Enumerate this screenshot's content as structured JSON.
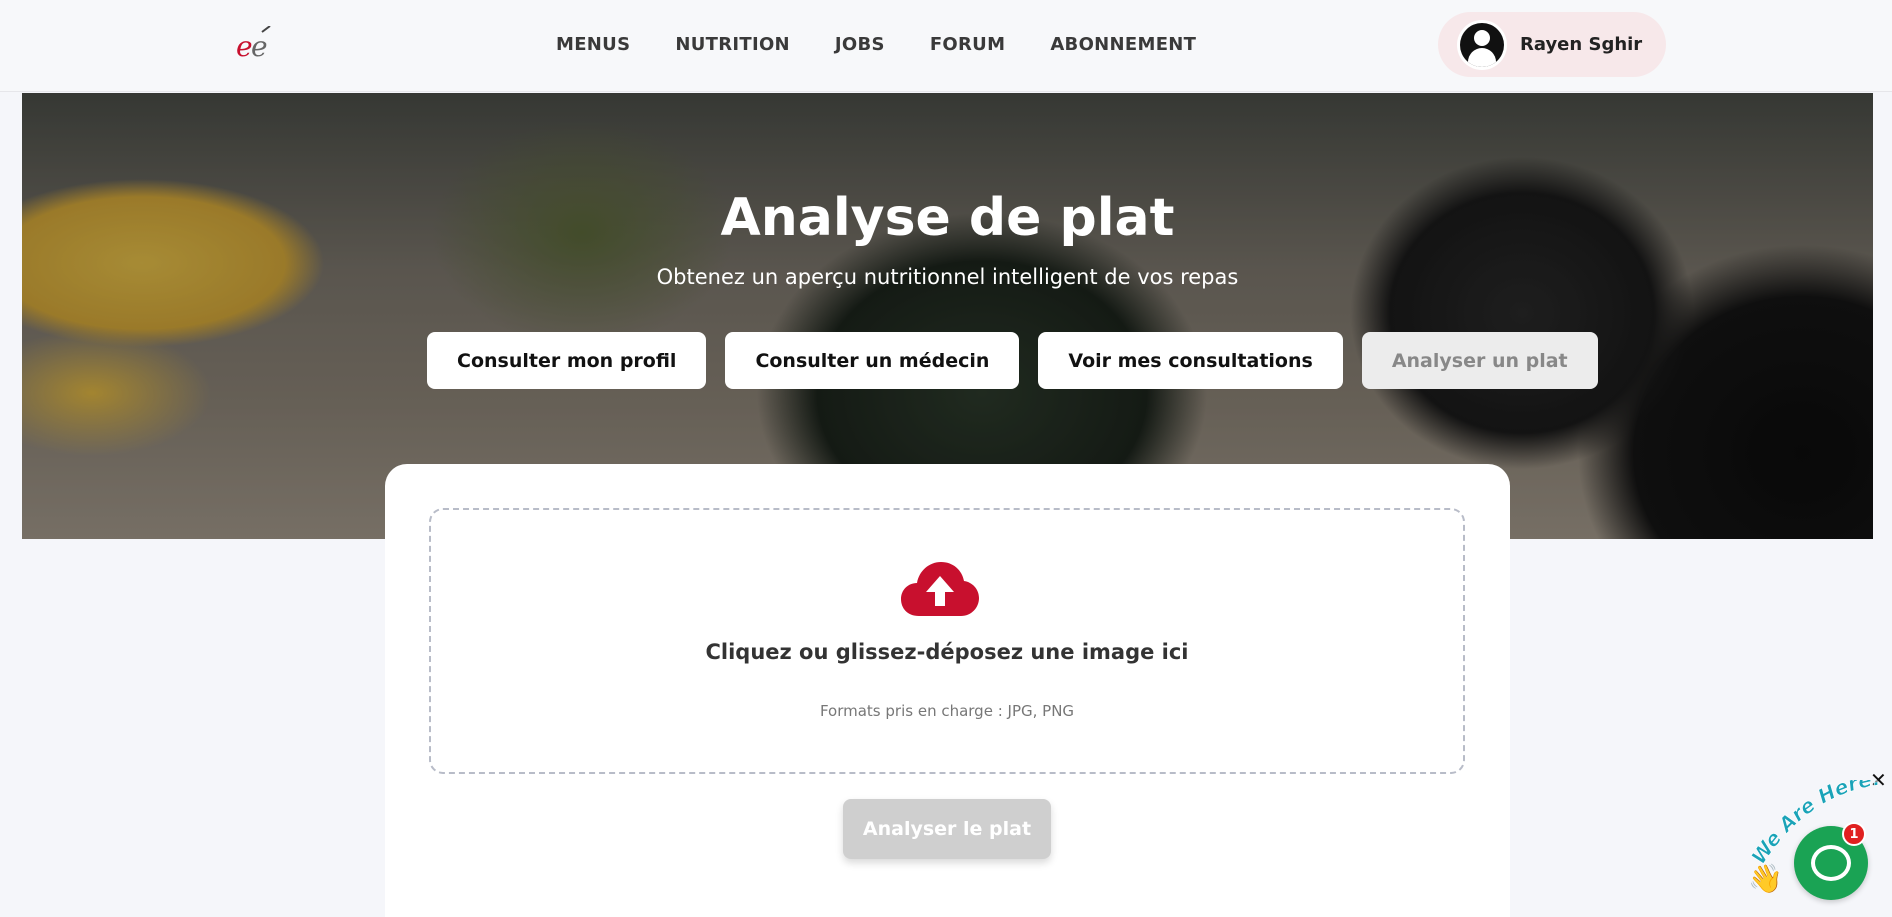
{
  "header": {
    "logo_text": "eé",
    "nav": [
      "MENUS",
      "NUTRITION",
      "JOBS",
      "FORUM",
      "ABONNEMENT"
    ],
    "user_name": "Rayen Sghir"
  },
  "hero": {
    "title": "Analyse de plat",
    "subtitle": "Obtenez un aperçu nutritionnel intelligent de vos repas",
    "buttons": [
      "Consulter mon profil",
      "Consulter un médecin",
      "Voir mes consultations",
      "Analyser un plat"
    ],
    "active_button": "Analyser un plat"
  },
  "upload": {
    "icon": "cloud-upload-icon",
    "title": "Cliquez ou glissez-déposez une image ici",
    "formats": "Formats pris en charge : JPG, PNG",
    "analyze_label": "Analyser le plat"
  },
  "chat": {
    "greeting": "We Are Here!",
    "badge_count": "1",
    "close_symbol": "✕",
    "hand_glyph": "👋"
  },
  "colors": {
    "brand_red": "#c8102e",
    "chat_green": "#1aa354",
    "badge_red": "#e02020"
  }
}
